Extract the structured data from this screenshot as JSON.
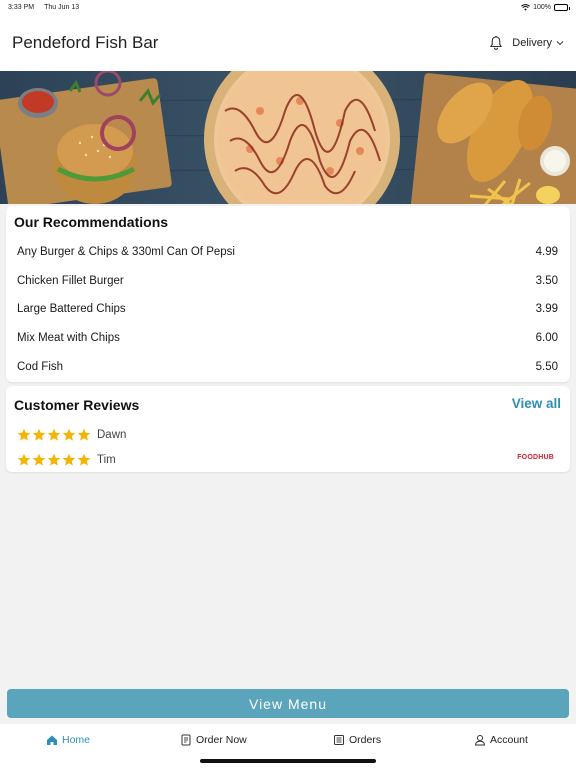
{
  "status_bar": {
    "time": "3:33 PM",
    "date": "Thu Jun 13",
    "battery": "100%"
  },
  "header": {
    "title": "Pendeford Fish Bar",
    "mode": "Delivery",
    "icons": [
      "bell-icon",
      "chevron-down-icon"
    ]
  },
  "recommendations": {
    "title": "Our Recommendations",
    "items": [
      {
        "name": "Any Burger & Chips & 330ml Can Of Pepsi",
        "price": "4.99"
      },
      {
        "name": "Chicken Fillet Burger",
        "price": "3.50"
      },
      {
        "name": "Large Battered Chips",
        "price": "3.99"
      },
      {
        "name": "Mix Meat with Chips",
        "price": "6.00"
      },
      {
        "name": "Cod Fish",
        "price": "5.50"
      }
    ]
  },
  "reviews": {
    "title": "Customer Reviews",
    "view_all": "View all",
    "items": [
      {
        "name": "Dawn",
        "stars": 5
      },
      {
        "name": "Tim",
        "stars": 5
      }
    ],
    "brand": "FOODHUB"
  },
  "view_menu": "View Menu",
  "tabs": [
    {
      "label": "Home",
      "icon": "home-icon",
      "active": true
    },
    {
      "label": "Order Now",
      "icon": "order-icon",
      "active": false
    },
    {
      "label": "Orders",
      "icon": "orders-list-icon",
      "active": false
    },
    {
      "label": "Account",
      "icon": "account-icon",
      "active": false
    }
  ],
  "colors": {
    "accent": "#2e8fb5",
    "button": "#5ba5bc",
    "star": "#f5b400",
    "brand_red": "#d41f2b"
  }
}
